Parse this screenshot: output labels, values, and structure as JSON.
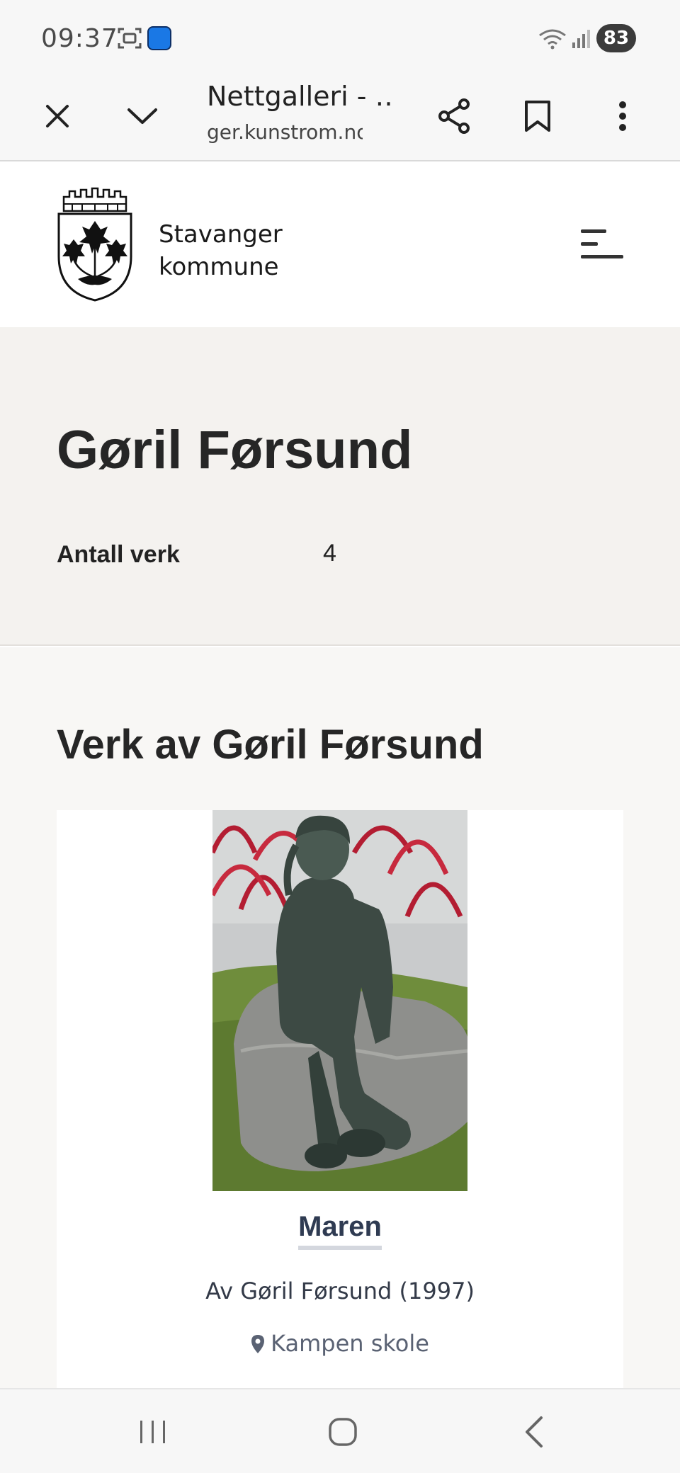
{
  "status_bar": {
    "time": "09:37",
    "battery": "83",
    "icons": [
      "screenshot-icon",
      "app-icon",
      "wifi-icon",
      "signal-icon"
    ]
  },
  "browser": {
    "tab_title": "Nettgalleri - …",
    "url": "ger.kunstrom.no",
    "icons": [
      "close-icon",
      "chevron-down-icon",
      "share-icon",
      "bookmark-icon",
      "more-icon"
    ]
  },
  "site": {
    "brand_line1": "Stavanger",
    "brand_line2": "kommune",
    "logo": "stavanger-coat-of-arms",
    "menu_icon": "hamburger-menu-icon"
  },
  "artist": {
    "name": "Gøril Førsund",
    "meta_label": "Antall verk",
    "meta_value": "4"
  },
  "works": {
    "heading": "Verk av Gøril Førsund",
    "items": [
      {
        "title": "Maren",
        "byline": "Av Gøril Førsund (1997)",
        "location": "Kampen skole",
        "location_icon": "map-pin-icon"
      }
    ]
  },
  "navbar": {
    "icons": [
      "recents-icon",
      "home-icon",
      "back-icon"
    ]
  },
  "colors": {
    "hero_bg": "#f4f2ef",
    "section_bg": "#f8f7f5",
    "title_link": "#2f3b52",
    "underline": "#d4d7de"
  }
}
